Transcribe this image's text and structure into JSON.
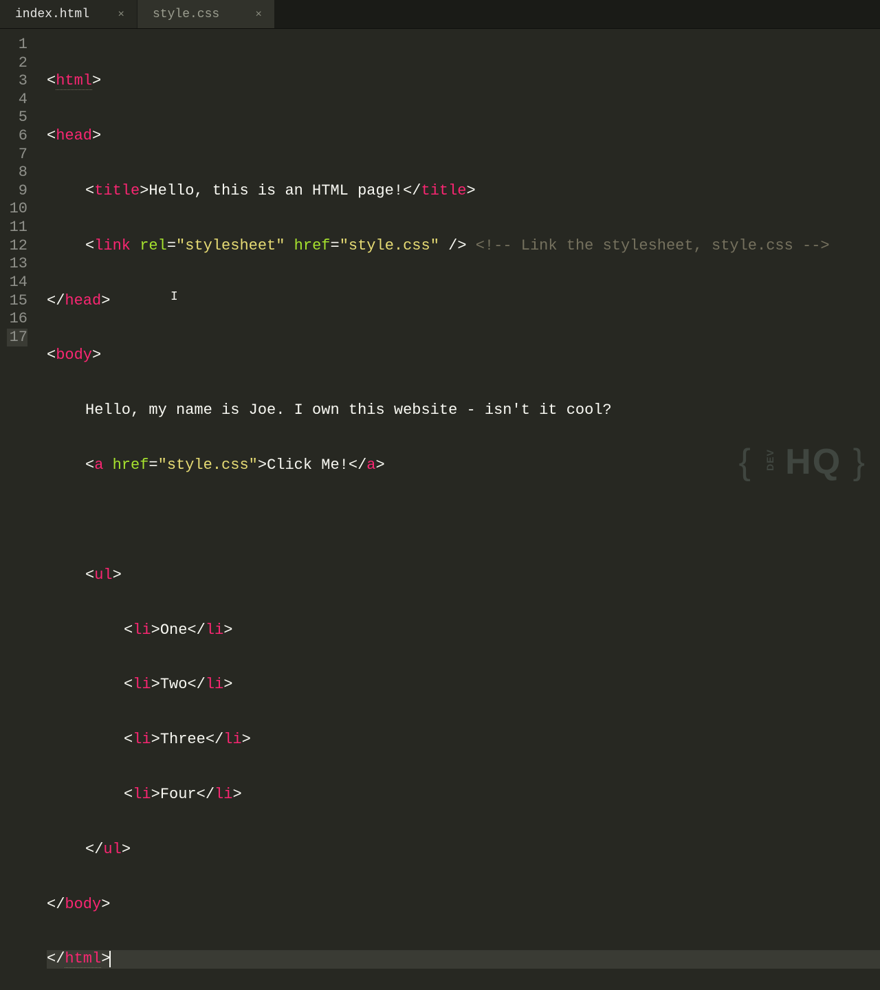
{
  "tabs": [
    {
      "label": "index.html",
      "active": true
    },
    {
      "label": "style.css",
      "active": false
    }
  ],
  "gutter": {
    "start": 1,
    "end": 17,
    "active": 17
  },
  "code": {
    "l1": {
      "tag": "html"
    },
    "l2": {
      "tag": "head"
    },
    "l3": {
      "tag": "title",
      "text": "Hello, this is an HTML page!"
    },
    "l4": {
      "tag": "link",
      "rel_attr": "rel",
      "rel_val": "\"stylesheet\"",
      "href_attr": "href",
      "href_val": "\"style.css\"",
      "comment": "<!-- Link the stylesheet, style.css -->"
    },
    "l5": {
      "tag": "head"
    },
    "l6": {
      "tag": "body"
    },
    "l7": {
      "text": "Hello, my name is Joe. I own this website - isn't it cool?"
    },
    "l8": {
      "tag": "a",
      "href_attr": "href",
      "href_val": "\"style.css\"",
      "text": "Click Me!"
    },
    "l10": {
      "tag": "ul"
    },
    "l11": {
      "tag": "li",
      "text": "One"
    },
    "l12": {
      "tag": "li",
      "text": "Two"
    },
    "l13": {
      "tag": "li",
      "text": "Three"
    },
    "l14": {
      "tag": "li",
      "text": "Four"
    },
    "l15": {
      "tag": "ul"
    },
    "l16": {
      "tag": "body"
    },
    "l17": {
      "tag": "html"
    }
  },
  "watermark": {
    "brace_l": "{",
    "dev": "DEV",
    "hq": "HQ",
    "brace_r": "}"
  }
}
